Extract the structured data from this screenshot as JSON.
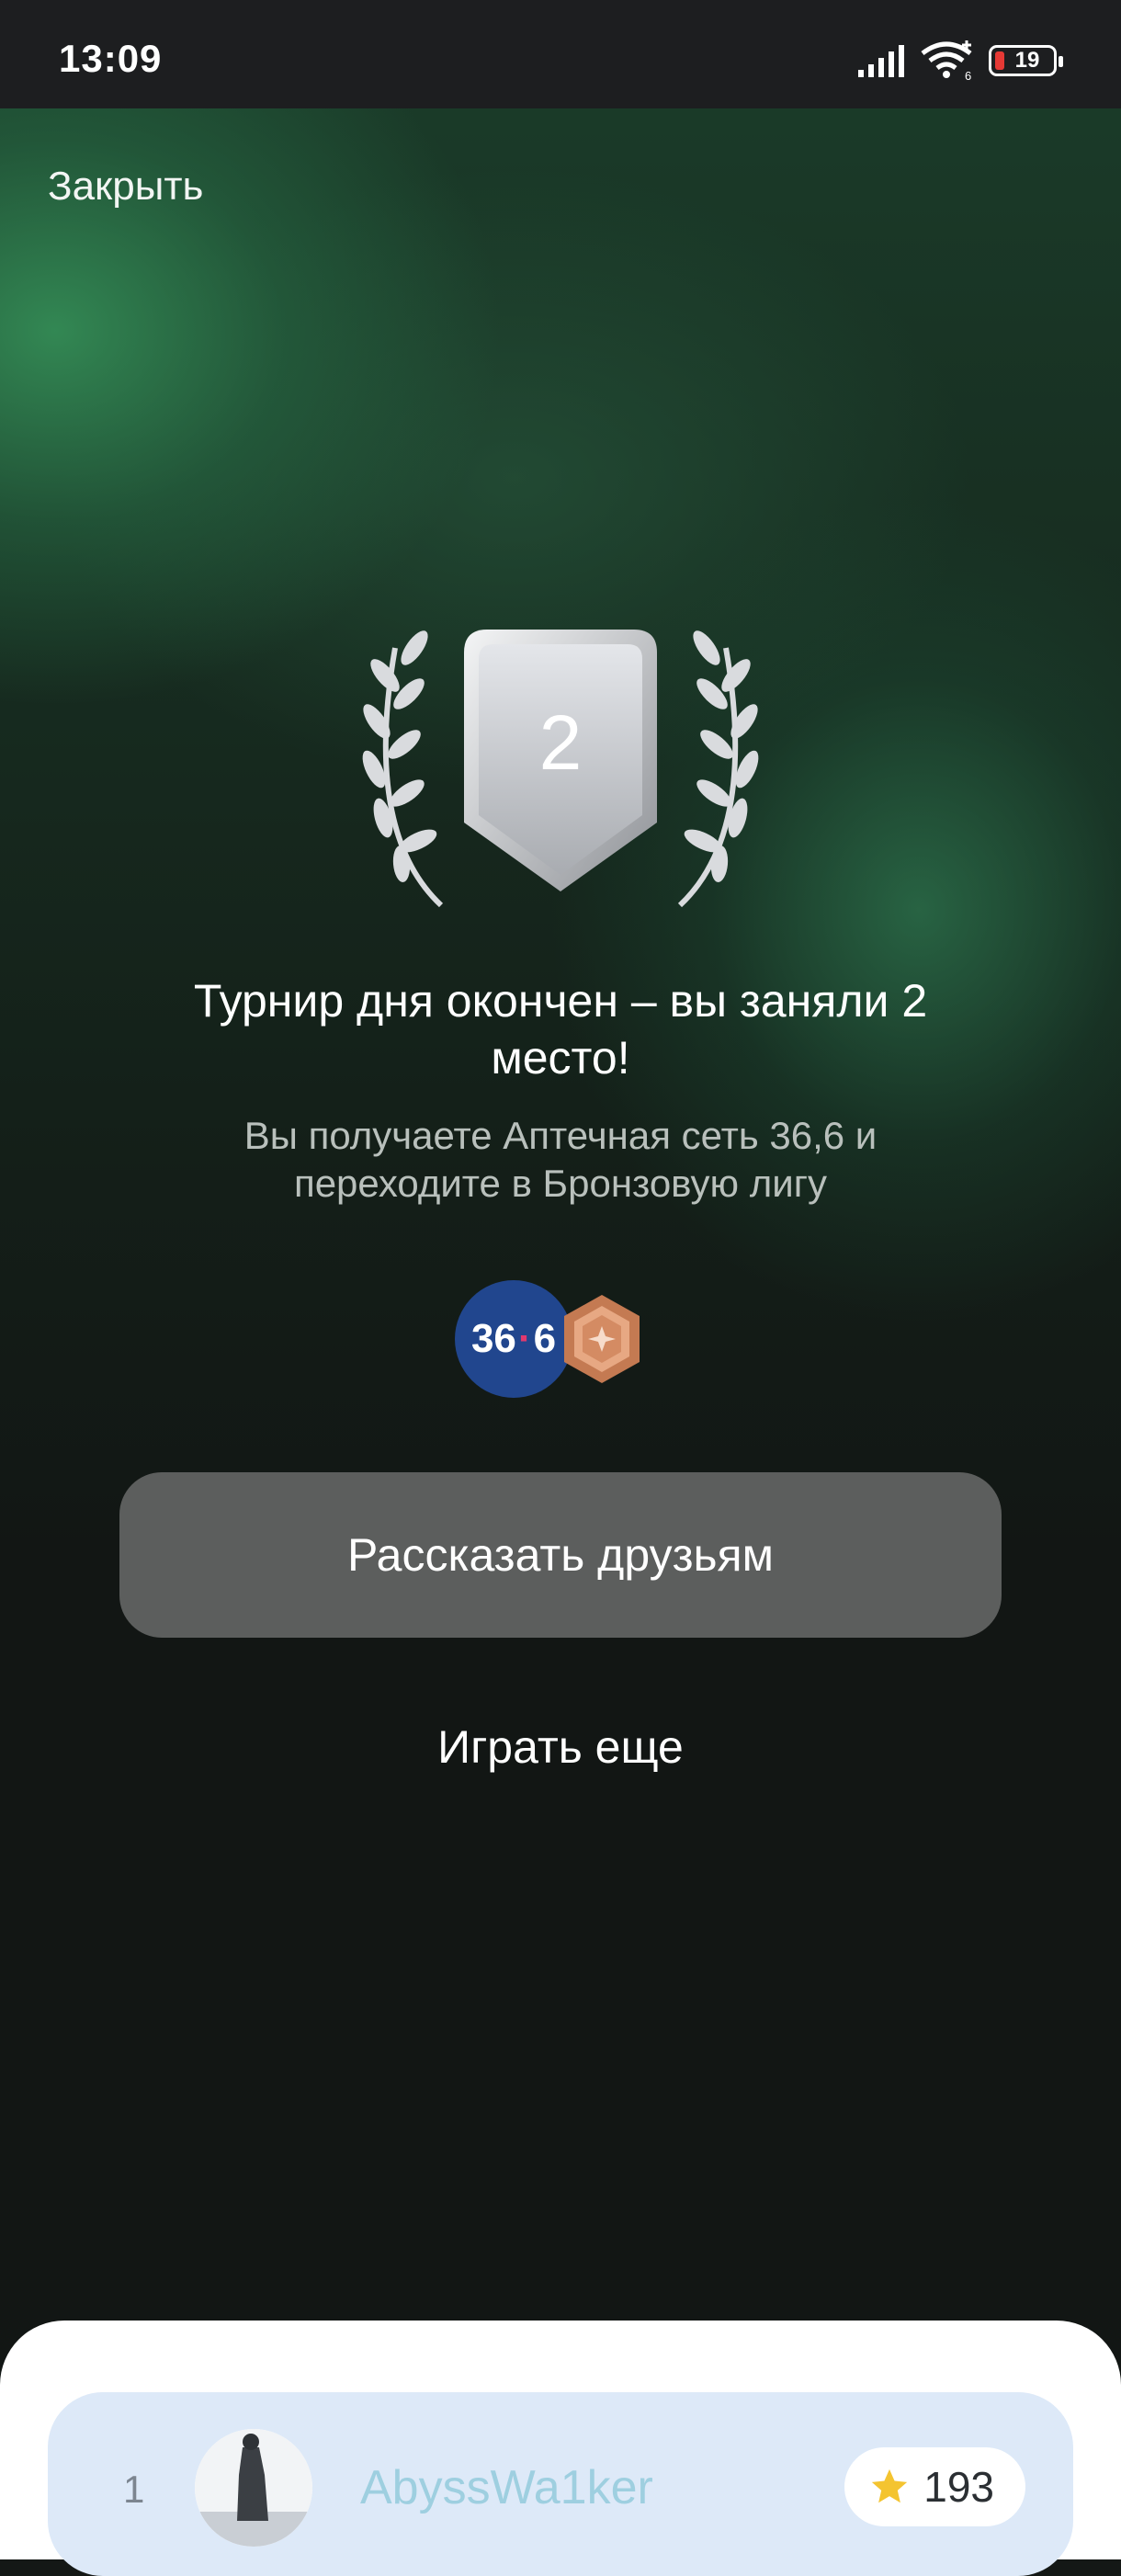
{
  "status_bar": {
    "time": "13:09",
    "battery_level": "19",
    "network": "6"
  },
  "header": {
    "close_label": "Закрыть"
  },
  "result": {
    "place": "2",
    "title": "Турнир дня окончен – вы заняли 2 место!",
    "subtitle": "Вы получаете Аптечная сеть 36,6 и переходите в Бронзовую лигу"
  },
  "prize": {
    "partner_logo_left": "36",
    "partner_logo_right": "6",
    "league_icon": "bronze-league-badge-icon"
  },
  "actions": {
    "share_label": "Рассказать друзьям",
    "play_again_label": "Играть еще"
  },
  "leaderboard": {
    "rows": [
      {
        "rank": "1",
        "name": "AbyssWa1ker",
        "score": "193"
      }
    ]
  },
  "colors": {
    "accent_green": "#2e7a50",
    "partner_blue": "#21468e",
    "bronze": "#d8926a",
    "button_gray": "#5c5e5d"
  }
}
